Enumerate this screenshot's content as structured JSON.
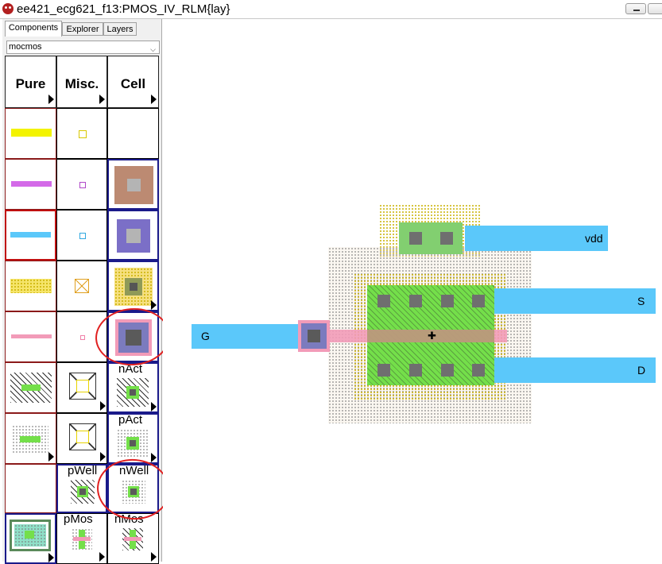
{
  "window": {
    "title": "ee421_ecg621_f13:PMOS_IV_RLM{lay}"
  },
  "tabs": [
    "Components",
    "Explorer",
    "Layers"
  ],
  "technology": {
    "selected": "mocmos"
  },
  "palette": {
    "headers": [
      "Pure",
      "Misc.",
      "Cell"
    ],
    "cell_labels": [
      "nAct",
      "pAct",
      "pWell",
      "nWell",
      "pMos",
      "nMos"
    ]
  },
  "layout": {
    "terminals": [
      "vdd",
      "S",
      "G",
      "D"
    ]
  },
  "icons": [
    "app-icon",
    "minimize-icon",
    "dropdown-arrow-icon",
    "submenu-arrow-icon",
    "cursor-icon"
  ],
  "colors": {
    "metal1": "#5bc8fa",
    "poly": "#f29bb8",
    "active": "#74df4a",
    "nwell": "#e8d400",
    "contact": "#6f6f6f",
    "highlight": "#e02020"
  }
}
